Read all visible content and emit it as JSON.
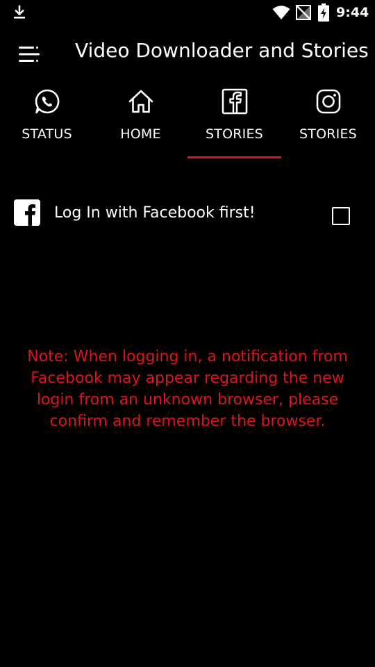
{
  "status_bar": {
    "time": "9:44",
    "icons": [
      "download-icon",
      "wifi-icon",
      "no-signal-icon",
      "battery-charging-icon"
    ]
  },
  "app_bar": {
    "title": "Video Downloader and Stories",
    "menu_icon": "menu-icon"
  },
  "tabs": [
    {
      "label": "STATUS",
      "icon": "whatsapp-icon",
      "selected": false
    },
    {
      "label": "HOME",
      "icon": "home-icon",
      "selected": false
    },
    {
      "label": "STORIES",
      "icon": "facebook-icon",
      "selected": true
    },
    {
      "label": "STORIES",
      "icon": "instagram-icon",
      "selected": false
    }
  ],
  "login": {
    "label": "Log In with Facebook first!",
    "icon": "facebook-icon",
    "checked": false
  },
  "note": {
    "text": "Note: When logging in, a notification from Facebook may appear regarding the new login from an unknown browser, please confirm and remember the browser."
  },
  "colors": {
    "background": "#000000",
    "text": "#ffffff",
    "accent": "#e0131b"
  }
}
